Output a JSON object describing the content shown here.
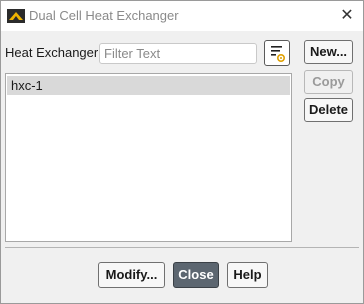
{
  "window": {
    "title": "Dual Cell Heat Exchanger",
    "close_glyph": "✕"
  },
  "filter": {
    "label": "Heat Exchanger",
    "placeholder": "Filter Text",
    "value": "",
    "icon": "filter-settings-icon"
  },
  "list": {
    "items": [
      {
        "label": "hxc-1",
        "selected": true
      }
    ]
  },
  "side_buttons": {
    "new_label": "New...",
    "copy_label": "Copy",
    "delete_label": "Delete"
  },
  "footer": {
    "modify_label": "Modify...",
    "close_label": "Close",
    "help_label": "Help"
  }
}
